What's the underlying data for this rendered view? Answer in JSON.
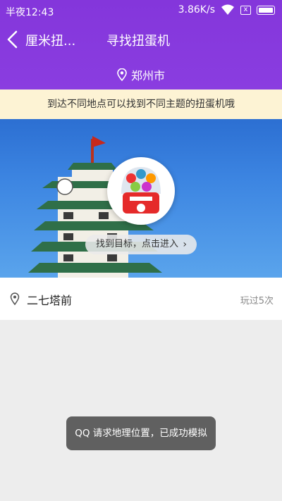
{
  "status_bar": {
    "time": "半夜12:43",
    "speed": "3.86K/s",
    "sim_icon": "x"
  },
  "nav": {
    "back_label": "厘米扭...",
    "title": "寻找扭蛋机"
  },
  "location": {
    "city": "郑州市"
  },
  "notice": {
    "text": "到达不同地点可以找到不同主题的扭蛋机哦"
  },
  "banner": {
    "enter_label": "找到目标，点击进入"
  },
  "place": {
    "name": "二七塔前",
    "play_count": "玩过5次"
  },
  "toast": {
    "text": "QQ 请求地理位置，已成功模拟"
  },
  "colors": {
    "header": "#8a3de0",
    "notice_bg": "#fdf3d4",
    "page_bg": "#ededed"
  },
  "icons": [
    "wifi-icon",
    "sim-icon",
    "battery-icon",
    "back-chevron-icon",
    "location-pin-icon",
    "chevron-right-icon"
  ]
}
